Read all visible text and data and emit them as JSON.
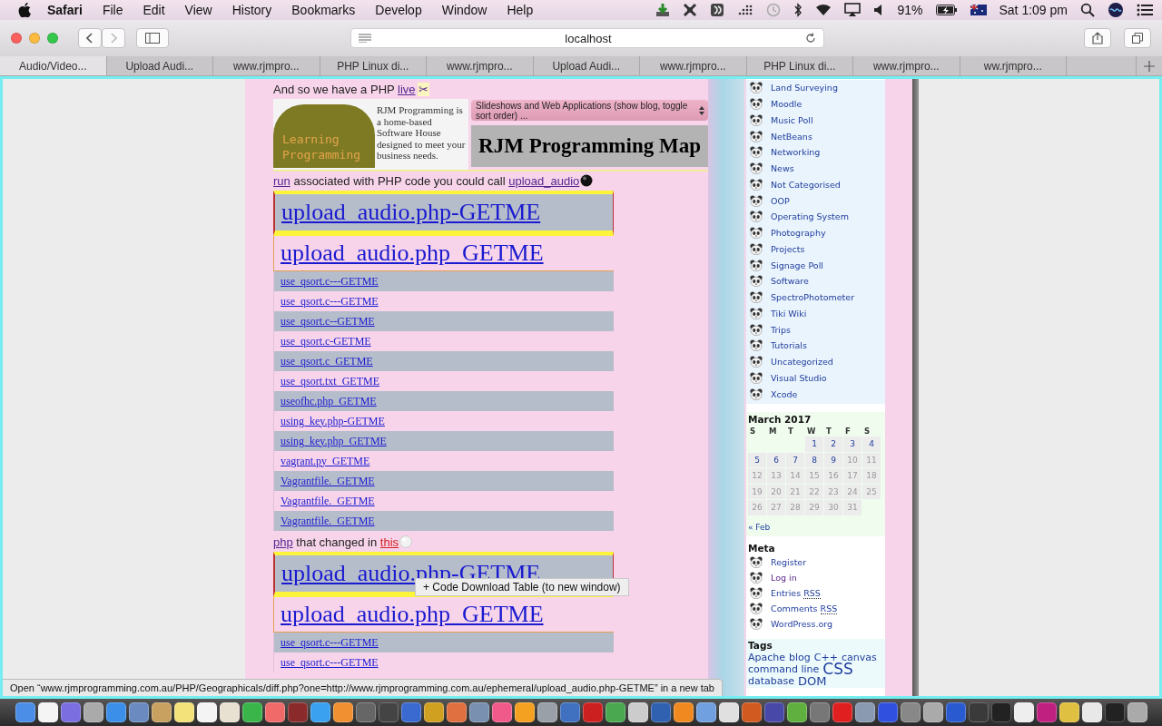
{
  "menubar": {
    "app": "Safari",
    "menus": [
      "File",
      "Edit",
      "View",
      "History",
      "Bookmarks",
      "Develop",
      "Window",
      "Help"
    ],
    "battery": "91%",
    "clock": "Sat 1:09 pm"
  },
  "toolbar": {
    "address": "localhost"
  },
  "tabs": [
    {
      "label": "Audio/Video...",
      "selected": true
    },
    {
      "label": "Upload Audi...",
      "selected": false
    },
    {
      "label": "www.rjmpro...",
      "selected": false
    },
    {
      "label": "PHP Linux di...",
      "selected": false
    },
    {
      "label": "www.rjmpro...",
      "selected": false
    },
    {
      "label": "Upload Audi...",
      "selected": false
    },
    {
      "label": "www.rjmpro...",
      "selected": false
    },
    {
      "label": "PHP Linux di...",
      "selected": false
    },
    {
      "label": "www.rjmpro...",
      "selected": false
    },
    {
      "label": "ww.rjmpro...",
      "selected": false
    }
  ],
  "page": {
    "intro": [
      {
        "kind": "text",
        "text": "And so we have a PHP "
      },
      {
        "kind": "visited",
        "text": "live"
      },
      {
        "kind": "icon",
        "text": "✂"
      }
    ],
    "header": {
      "blurb": "RJM Programming is a home-based Software House designed to meet your business needs.",
      "logo": "Learning Programming",
      "select": "Slideshows and Web Applications (show blog, toggle sort order) ...",
      "map_title": "RJM Programming Map"
    },
    "sections": [
      {
        "line": [
          {
            "kind": "visited",
            "text": "run"
          },
          {
            "kind": "text",
            "text": " associated with PHP code you could call "
          },
          {
            "kind": "visited",
            "text": "upload_audio"
          }
        ],
        "kind": "dark",
        "files": [
          {
            "name": "upload_audio.php-GETME",
            "kind": "large",
            "selected": true
          },
          {
            "name": "upload_audio.php_GETME",
            "kind": "large",
            "selected": false
          },
          {
            "name": "use_qsort.c---GETME",
            "kind": "small",
            "selected": false
          },
          {
            "name": "use_qsort.c---GETME",
            "kind": "small",
            "selected": false
          },
          {
            "name": "use_qsort.c--GETME",
            "kind": "small",
            "selected": false
          },
          {
            "name": "use_qsort.c-GETME",
            "kind": "small",
            "selected": false
          },
          {
            "name": "use_qsort.c_GETME",
            "kind": "small",
            "selected": false
          },
          {
            "name": "use_qsort.txt_GETME",
            "kind": "small",
            "selected": false
          },
          {
            "name": "useofhc.php_GETME",
            "kind": "small",
            "selected": false
          },
          {
            "name": "using_key.php-GETME",
            "kind": "small",
            "selected": false
          },
          {
            "name": "using_key.php_GETME",
            "kind": "small",
            "selected": false
          },
          {
            "name": "vagrant.py_GETME",
            "kind": "small",
            "selected": false
          },
          {
            "name": "Vagrantfile._GETME",
            "kind": "small",
            "selected": false
          },
          {
            "name": "Vagrantfile._GETME",
            "kind": "small",
            "selected": false
          },
          {
            "name": "Vagrantfile._GETME",
            "kind": "small",
            "selected": false
          }
        ]
      },
      {
        "line": [
          {
            "kind": "visited",
            "text": "php"
          },
          {
            "kind": "text",
            "text": " that changed in "
          },
          {
            "kind": "active",
            "text": "this"
          }
        ],
        "kind": "light",
        "tooltip": "+ Code Download Table (to new window)",
        "files": [
          {
            "name": "upload_audio.php-GETME",
            "kind": "large",
            "selected": true
          },
          {
            "name": "upload_audio.php_GETME",
            "kind": "large",
            "selected": false
          },
          {
            "name": "use_qsort.c---GETME",
            "kind": "small",
            "selected": false
          },
          {
            "name": "use_qsort.c---GETME",
            "kind": "small",
            "selected": false
          }
        ]
      }
    ]
  },
  "sidebar": {
    "categories": [
      "Land Surveying",
      "Moodle",
      "Music Poll",
      "NetBeans",
      "Networking",
      "News",
      "Not Categorised",
      "OOP",
      "Operating System",
      "Photography",
      "Projects",
      "Signage Poll",
      "Software",
      "SpectroPhotometer",
      "Tiki Wiki",
      "Trips",
      "Tutorials",
      "Uncategorized",
      "Visual Studio",
      "Xcode"
    ],
    "calendar": {
      "caption": "March 2017",
      "weekdays": [
        "S",
        "M",
        "T",
        "W",
        "T",
        "F",
        "S"
      ],
      "weeks": [
        {
          "kind": "end",
          "days": [
            {
              "day": "1",
              "linked": true
            },
            {
              "day": "2",
              "linked": true
            },
            {
              "day": "3",
              "linked": true
            },
            {
              "day": "4",
              "linked": true
            }
          ]
        },
        {
          "kind": "start",
          "days": [
            {
              "day": "5",
              "linked": true
            },
            {
              "day": "6",
              "linked": true
            },
            {
              "day": "7",
              "linked": true
            },
            {
              "day": "8",
              "linked": true
            },
            {
              "day": "9",
              "linked": true
            },
            {
              "day": "10",
              "linked": false
            },
            {
              "day": "11",
              "linked": false
            }
          ]
        },
        {
          "kind": "start",
          "days": [
            {
              "day": "12",
              "linked": false
            },
            {
              "day": "13",
              "linked": false
            },
            {
              "day": "14",
              "linked": false
            },
            {
              "day": "15",
              "linked": false
            },
            {
              "day": "16",
              "linked": false
            },
            {
              "day": "17",
              "linked": false
            },
            {
              "day": "18",
              "linked": false
            }
          ]
        },
        {
          "kind": "start",
          "days": [
            {
              "day": "19",
              "linked": false
            },
            {
              "day": "20",
              "linked": false
            },
            {
              "day": "21",
              "linked": false
            },
            {
              "day": "22",
              "linked": false
            },
            {
              "day": "23",
              "linked": false
            },
            {
              "day": "24",
              "linked": false
            },
            {
              "day": "25",
              "linked": false
            }
          ]
        },
        {
          "kind": "start",
          "days": [
            {
              "day": "26",
              "linked": false
            },
            {
              "day": "27",
              "linked": false
            },
            {
              "day": "28",
              "linked": false
            },
            {
              "day": "29",
              "linked": false
            },
            {
              "day": "30",
              "linked": false
            },
            {
              "day": "31",
              "linked": false
            }
          ]
        }
      ],
      "prev": "« Feb"
    },
    "meta": {
      "title": "Meta",
      "items": [
        {
          "text": "Register",
          "visited": false
        },
        {
          "text": "Log in",
          "visited": true
        },
        {
          "text": "Entries",
          "abbr": "RSS",
          "visited": false
        },
        {
          "text": "Comments",
          "abbr": "RSS",
          "visited": false
        },
        {
          "text": "WordPress.org",
          "visited": false
        }
      ]
    },
    "tags": {
      "title": "Tags",
      "items": [
        {
          "text": "Apache",
          "kind": "medium"
        },
        {
          "text": "blog",
          "kind": "medium"
        },
        {
          "text": "C++",
          "kind": "medium"
        },
        {
          "text": "canvas",
          "kind": "medium"
        },
        {
          "text": "command line",
          "kind": "medium"
        },
        {
          "text": "CSS",
          "kind": "large"
        },
        {
          "text": "database",
          "kind": "medium"
        },
        {
          "text": "DOM",
          "kind": "big"
        }
      ]
    }
  },
  "status": "Open “www.rjmprogramming.com.au/PHP/Geographicals/diff.php?one=http://www.rjmprogramming.com.au/ephemeral/upload_audio.php-GETME” in a new tab"
}
